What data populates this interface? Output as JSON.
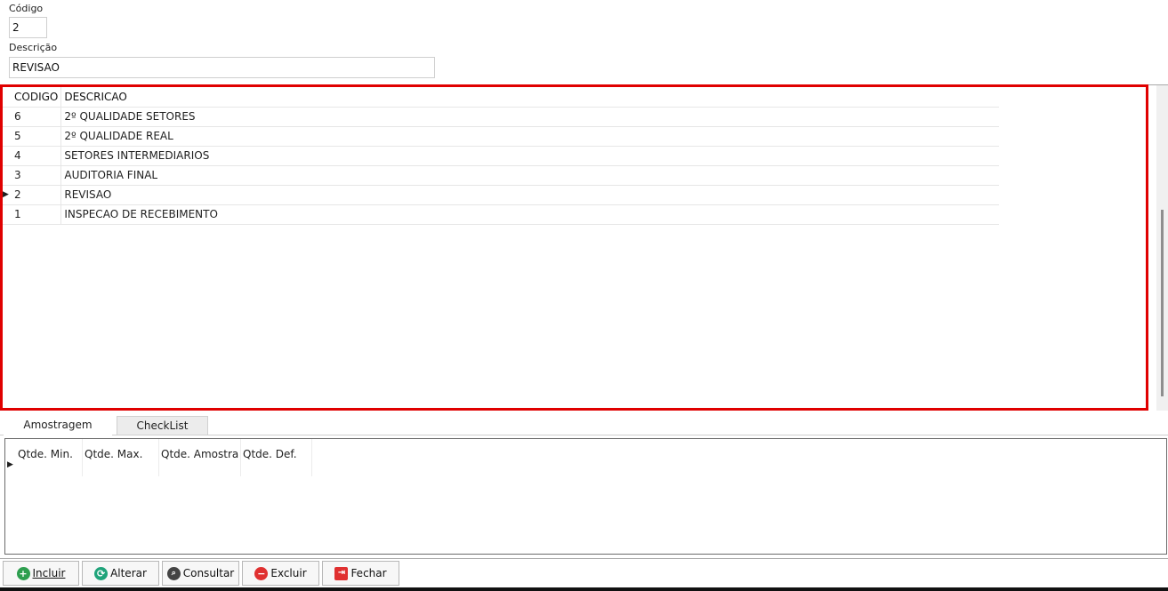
{
  "form": {
    "codigo_label": "Código",
    "codigo_value": "2",
    "descricao_label": "Descrição",
    "descricao_value": "REVISAO"
  },
  "grid": {
    "headers": [
      "CODIGO",
      "DESCRICAO"
    ],
    "rows": [
      {
        "codigo": "6",
        "descricao": "2º QUALIDADE SETORES"
      },
      {
        "codigo": "5",
        "descricao": "2º QUALIDADE REAL"
      },
      {
        "codigo": "4",
        "descricao": "SETORES INTERMEDIARIOS"
      },
      {
        "codigo": "3",
        "descricao": "AUDITORIA FINAL"
      },
      {
        "codigo": "2",
        "descricao": "REVISAO"
      },
      {
        "codigo": "1",
        "descricao": "INSPECAO DE RECEBIMENTO"
      }
    ],
    "current_row_index": 4,
    "highlight_color": "#e00000"
  },
  "tabs": [
    {
      "label": "Amostragem",
      "active": true
    },
    {
      "label": "CheckList",
      "active": false
    }
  ],
  "sub_grid": {
    "headers": [
      "Qtde. Min.",
      "Qtde. Max.",
      "Qtde. Amostra",
      "Qtde. Def."
    ]
  },
  "toolbar": {
    "incluir": {
      "label": "Incluir",
      "icon": "plus-circle-icon",
      "color": "#2e9e4f"
    },
    "alterar": {
      "label": "Alterar",
      "icon": "refresh-icon",
      "color": "#1fa37a"
    },
    "consultar": {
      "label": "Consultar",
      "icon": "search-icon",
      "color": "#444444"
    },
    "excluir": {
      "label": "Excluir",
      "icon": "minus-circle-icon",
      "color": "#e03030"
    },
    "fechar": {
      "label": "Fechar",
      "icon": "exit-icon",
      "color": "#e03030"
    }
  }
}
